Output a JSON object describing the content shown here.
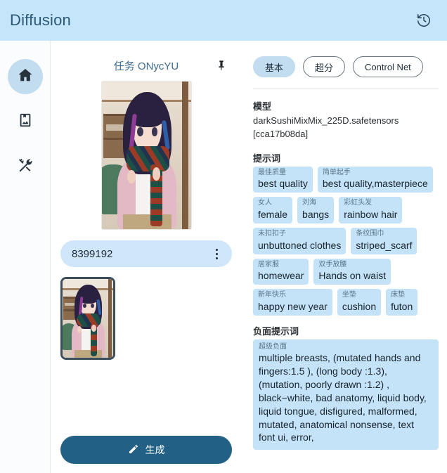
{
  "header": {
    "title": "Diffusion",
    "history_icon": "history-icon"
  },
  "sidebar": {
    "items": [
      {
        "icon": "home-icon",
        "name": "home",
        "active": true
      },
      {
        "icon": "gallery-icon",
        "name": "gallery",
        "active": false
      },
      {
        "icon": "tools-icon",
        "name": "tools",
        "active": false
      }
    ]
  },
  "center": {
    "task_title": "任务 ONycYU",
    "pin_icon": "pin-icon",
    "id_value": "8399192",
    "more_icon": "more-vertical-icon",
    "generate_label": "生成",
    "generate_icon": "pencil-icon"
  },
  "right": {
    "tabs": [
      {
        "label": "基本",
        "active": true
      },
      {
        "label": "超分",
        "active": false
      },
      {
        "label": "Control Net",
        "active": false
      }
    ],
    "model": {
      "label": "模型",
      "value": "darkSushiMixMix_225D.safetensors [cca17b08da]"
    },
    "prompt": {
      "label": "提示词",
      "tags": [
        {
          "cn": "最佳质量",
          "en": "best quality"
        },
        {
          "cn": "简单起手",
          "en": "best quality,masterpiece"
        },
        {
          "cn": "女人",
          "en": "female"
        },
        {
          "cn": "刘海",
          "en": "bangs"
        },
        {
          "cn": "彩虹头发",
          "en": "rainbow hair"
        },
        {
          "cn": "未扣扣子",
          "en": "unbuttoned clothes"
        },
        {
          "cn": "条纹围巾",
          "en": "striped_scarf"
        },
        {
          "cn": "居家服",
          "en": "homewear"
        },
        {
          "cn": "双手放腰",
          "en": "Hands on waist"
        },
        {
          "cn": "新年快乐",
          "en": "happy new year"
        },
        {
          "cn": "坐垫",
          "en": "cushion"
        },
        {
          "cn": "床垫",
          "en": "futon"
        }
      ]
    },
    "negative_prompt": {
      "label": "负面提示词",
      "tag_cn": "超级负面",
      "text": "multiple breasts, (mutated hands and fingers:1.5 ), (long body :1.3), (mutation, poorly drawn :1.2) , black−white, bad anatomy, liquid body, liquid tongue, disfigured, malformed, mutated, anatomical nonsense, text font ui, error,"
    }
  },
  "colors": {
    "header_bg": "#c5e5fb",
    "accent": "#226185",
    "tag_bg": "#c5e3f8",
    "active_pill": "#c2dcf0"
  }
}
